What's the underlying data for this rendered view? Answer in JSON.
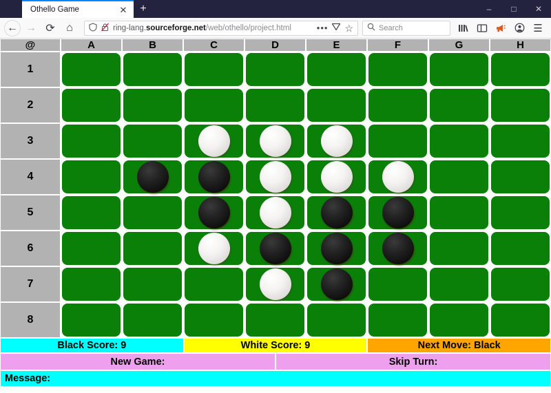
{
  "window": {
    "tab_title": "Othello Game",
    "close_tab_glyph": "✕",
    "new_tab_glyph": "+",
    "minimize_glyph": "–",
    "maximize_glyph": "□",
    "close_glyph": "✕"
  },
  "toolbar": {
    "back_glyph": "←",
    "forward_glyph": "→",
    "reload_glyph": "⟳",
    "home_glyph": "⌂",
    "url_prefix": "ring-lang.",
    "url_host": "sourceforge.net",
    "url_path": "/web/othello/project.html",
    "page_actions_glyph": "•••",
    "reader_glyph": "♡",
    "bookmark_glyph": "☆",
    "search_placeholder": "Search",
    "library_glyph": "∥\\",
    "sidebar_glyph": "◫",
    "megaphone_glyph": "📣",
    "account_glyph": "●",
    "menu_glyph": "☰",
    "accent_color": "#0a84ff",
    "megaphone_color": "#e25718"
  },
  "board": {
    "corner_label": "@",
    "columns": [
      "A",
      "B",
      "C",
      "D",
      "E",
      "F",
      "G",
      "H"
    ],
    "rows": [
      "1",
      "2",
      "3",
      "4",
      "5",
      "6",
      "7",
      "8"
    ],
    "cell_color": "#0a8009",
    "label_color": "#b2b2b2",
    "grid": [
      [
        "",
        "",
        "",
        "",
        "",
        "",
        "",
        ""
      ],
      [
        "",
        "",
        "",
        "",
        "",
        "",
        "",
        ""
      ],
      [
        "",
        "",
        "W",
        "W",
        "W",
        "",
        "",
        ""
      ],
      [
        "",
        "B",
        "B",
        "W",
        "W",
        "W",
        "",
        ""
      ],
      [
        "",
        "",
        "B",
        "W",
        "B",
        "B",
        "",
        ""
      ],
      [
        "",
        "",
        "W",
        "B",
        "B",
        "B",
        "",
        ""
      ],
      [
        "",
        "",
        "",
        "W",
        "B",
        "",
        "",
        ""
      ],
      [
        "",
        "",
        "",
        "",
        "",
        "",
        "",
        ""
      ]
    ]
  },
  "status": {
    "black_score": "Black Score: 9",
    "white_score": "White Score: 9",
    "next_move": "Next Move: Black",
    "black_color": "#00ffff",
    "white_color": "#ffff00",
    "next_color": "#ffa500"
  },
  "buttons": {
    "new_game": "New Game:",
    "skip_turn": "Skip Turn:",
    "button_color": "#ee9fee"
  },
  "message": {
    "label": "Message:",
    "background": "#00ffff"
  }
}
